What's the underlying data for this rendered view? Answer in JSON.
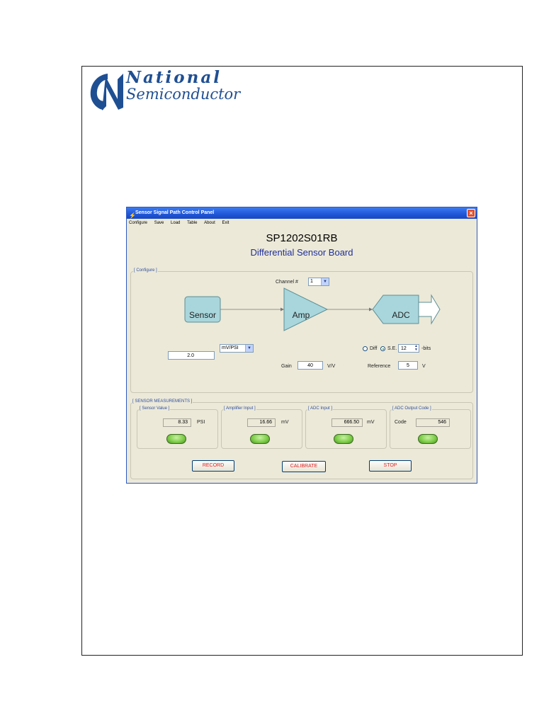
{
  "logo": {
    "line1": "National",
    "line2": "Semiconductor"
  },
  "window": {
    "title": "Sensor Signal Path Control Panel",
    "menu": [
      "Configure",
      "Save",
      "Load",
      "Table",
      "About",
      "Exit"
    ],
    "app_title": "SP1202S01RB",
    "app_subtitle": "Differential Sensor Board"
  },
  "configure": {
    "group_label": "[ Configure ]",
    "channel_label": "Channel #",
    "channel_value": "1",
    "blocks": {
      "sensor": "Sensor",
      "amp": "Amp",
      "adc": "ADC"
    },
    "sensitivity_value": "2.0",
    "sensitivity_unit": "mV/PSI",
    "diff_label": "Diff",
    "se_label": "S.E.",
    "mode_selected": "S.E.",
    "bits_value": "12",
    "bits_label": "-bits",
    "gain_label": "Gain",
    "gain_value": "40",
    "gain_unit": "V/V",
    "reference_label": "Reference",
    "reference_value": "5",
    "reference_unit": "V"
  },
  "measurements": {
    "group_label": "[ SENSOR MEASUREMENTS ]",
    "panels": [
      {
        "label": "[ Sensor Value ]",
        "prefix": "",
        "value": "8.33",
        "unit": "PSI"
      },
      {
        "label": "[ Amplifier Input ]",
        "prefix": "",
        "value": "16.66",
        "unit": "mV"
      },
      {
        "label": "[ ADC Input ]",
        "prefix": "",
        "value": "666.50",
        "unit": "mV"
      },
      {
        "label": "[ ADC Output Code ]",
        "prefix": "Code",
        "value": "546",
        "unit": ""
      }
    ]
  },
  "buttons": {
    "record": "RECORD",
    "calibrate": "CALIBRATE",
    "stop": "STOP"
  },
  "colors": {
    "titlebar": "#1f55d8",
    "block_fill": "#a8d6dc",
    "led": "#7fcf4a",
    "subtitle": "#1f2f9a",
    "button_text": "#e02020"
  }
}
